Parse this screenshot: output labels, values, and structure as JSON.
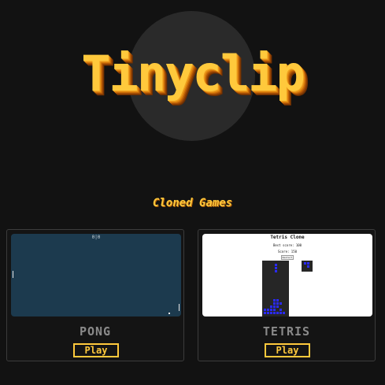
{
  "header": {
    "logo": "Tinyclip"
  },
  "section": {
    "title": "Cloned Games"
  },
  "games": [
    {
      "name": "PONG",
      "play_label": "Play",
      "preview_score": "0|0"
    },
    {
      "name": "TETRIS",
      "play_label": "Play",
      "preview_title": "Tetris Clone",
      "preview_best": "Best score: 100",
      "preview_score": "Score: 150",
      "preview_button": "Restart"
    }
  ],
  "colors": {
    "background": "#121212",
    "accent": "#ffc93c",
    "pong_field": "#1c3a4e",
    "tetris_block": "#2a2aff"
  }
}
